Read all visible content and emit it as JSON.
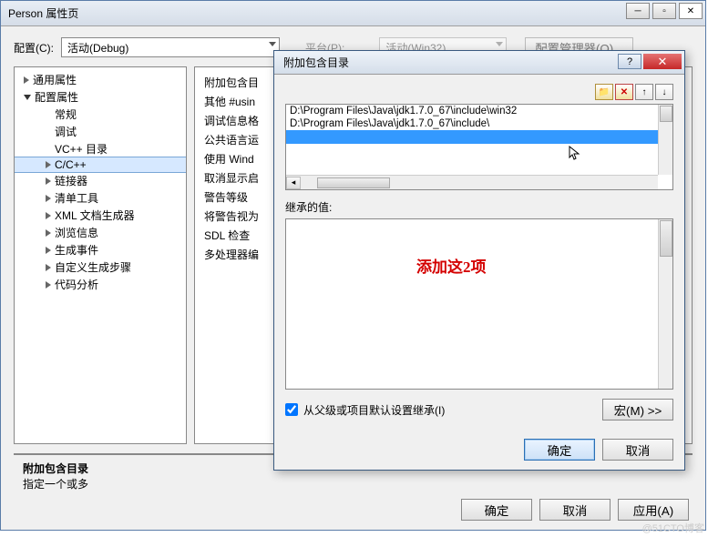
{
  "main": {
    "title": "Person 属性页",
    "config_label": "配置(C):",
    "config_value": "活动(Debug)",
    "platform_label": "平台(P):",
    "platform_value": "活动(Win32)",
    "config_manager_btn": "配置管理器(O)..."
  },
  "tree": [
    {
      "label": "通用属性",
      "level": 1,
      "tri": "closed"
    },
    {
      "label": "配置属性",
      "level": 1,
      "tri": "open"
    },
    {
      "label": "常规",
      "level": 2
    },
    {
      "label": "调试",
      "level": 2
    },
    {
      "label": "VC++ 目录",
      "level": 2
    },
    {
      "label": "C/C++",
      "level": 2,
      "tri": "closed",
      "selected": true
    },
    {
      "label": "链接器",
      "level": 2,
      "tri": "closed"
    },
    {
      "label": "清单工具",
      "level": 2,
      "tri": "closed"
    },
    {
      "label": "XML 文档生成器",
      "level": 2,
      "tri": "closed"
    },
    {
      "label": "浏览信息",
      "level": 2,
      "tri": "closed"
    },
    {
      "label": "生成事件",
      "level": 2,
      "tri": "closed"
    },
    {
      "label": "自定义生成步骤",
      "level": 2,
      "tri": "closed"
    },
    {
      "label": "代码分析",
      "level": 2,
      "tri": "closed"
    }
  ],
  "props": [
    "附加包含目",
    "其他 #usin",
    "调试信息格",
    "公共语言运",
    "使用 Wind",
    "取消显示启",
    "警告等级",
    "将警告视为",
    "SDL 检查",
    "多处理器编"
  ],
  "prop_footer": {
    "title": "附加包含目录",
    "desc": "指定一个或多"
  },
  "main_buttons": {
    "ok": "确定",
    "cancel": "取消",
    "apply": "应用(A)"
  },
  "modal": {
    "title": "附加包含目录",
    "paths": [
      "D:\\Program Files\\Java\\jdk1.7.0_67\\include\\win32",
      "D:\\Program Files\\Java\\jdk1.7.0_67\\include\\"
    ],
    "inherit_label": "继承的值:",
    "inherit_checkbox": "从父级或项目默认设置继承(I)",
    "macro_btn": "宏(M) >>",
    "ok": "确定",
    "cancel": "取消",
    "annotation": "添加这2项"
  },
  "toolbar_icons": {
    "new": "📁",
    "del": "✕",
    "up": "↑",
    "down": "↓"
  },
  "watermark": "@51CTO博客"
}
